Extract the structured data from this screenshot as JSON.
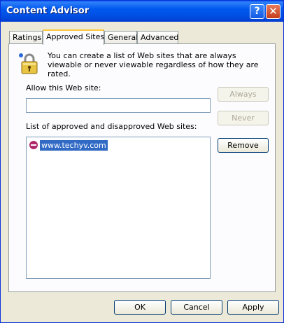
{
  "window": {
    "title": "Content Advisor"
  },
  "title_buttons": {
    "help": "?",
    "close": "✕"
  },
  "tabs": [
    {
      "label": "Ratings",
      "active": false
    },
    {
      "label": "Approved Sites",
      "active": true
    },
    {
      "label": "General",
      "active": false
    },
    {
      "label": "Advanced",
      "active": false
    }
  ],
  "approved_sites": {
    "icon": "lock-icon",
    "description": "You can create a list of Web sites that are always viewable or never viewable regardless of how they are rated.",
    "allow_label": "Allow this Web site:",
    "allow_value": "",
    "always_button": "Always",
    "never_button": "Never",
    "list_label": "List of approved and disapproved Web sites:",
    "list_items": [
      {
        "icon": "block-icon",
        "text": "www.techyv.com",
        "selected": true
      }
    ],
    "remove_button": "Remove"
  },
  "footer": {
    "ok": "OK",
    "cancel": "Cancel",
    "apply": "Apply"
  },
  "colors": {
    "titlebar": "#0058ee",
    "selection": "#316ac5",
    "disapproved_icon": "#b0296a",
    "tab_highlight": "#ffc83c"
  }
}
